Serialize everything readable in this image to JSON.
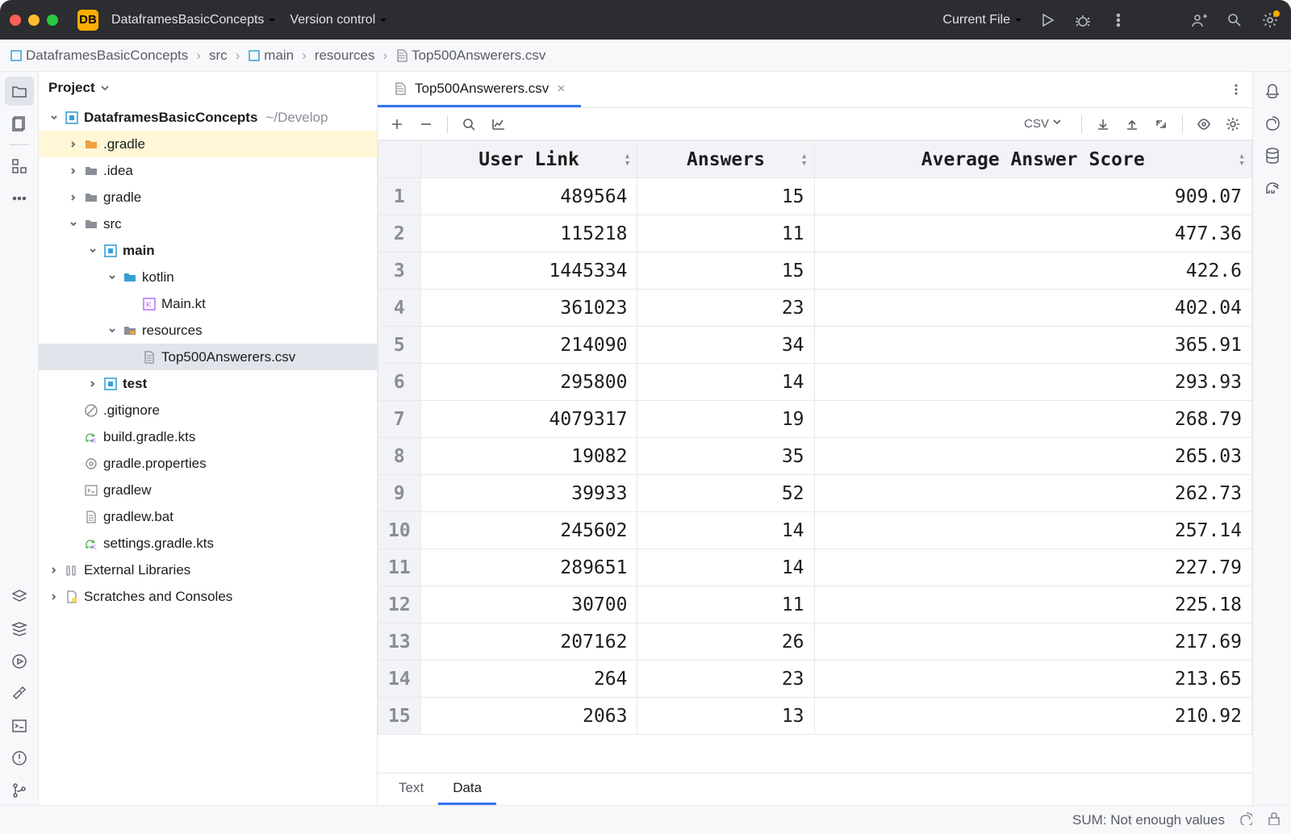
{
  "titlebar": {
    "project_name": "DataframesBasicConcepts",
    "version_control": "Version control",
    "run_target": "Current File"
  },
  "breadcrumb": {
    "items": [
      {
        "label": "DataframesBasicConcepts",
        "icon": "module"
      },
      {
        "label": "src"
      },
      {
        "label": "main",
        "icon": "module"
      },
      {
        "label": "resources"
      },
      {
        "label": "Top500Answerers.csv",
        "icon": "file"
      }
    ]
  },
  "project": {
    "title": "Project",
    "root": {
      "label": "DataframesBasicConcepts",
      "hint": "~/Develop"
    },
    "tree": [
      {
        "label": ".gradle",
        "depth": 1,
        "arrow": "right",
        "icon": "folder-orange",
        "highlighted": true
      },
      {
        "label": ".idea",
        "depth": 1,
        "arrow": "right",
        "icon": "folder"
      },
      {
        "label": "gradle",
        "depth": 1,
        "arrow": "right",
        "icon": "folder"
      },
      {
        "label": "src",
        "depth": 1,
        "arrow": "down",
        "icon": "folder"
      },
      {
        "label": "main",
        "depth": 2,
        "arrow": "down",
        "icon": "module",
        "bold": true
      },
      {
        "label": "kotlin",
        "depth": 3,
        "arrow": "down",
        "icon": "folder-blue"
      },
      {
        "label": "Main.kt",
        "depth": 4,
        "arrow": "",
        "icon": "kt-file"
      },
      {
        "label": "resources",
        "depth": 3,
        "arrow": "down",
        "icon": "folder-res"
      },
      {
        "label": "Top500Answerers.csv",
        "depth": 4,
        "arrow": "",
        "icon": "file",
        "selected": true
      },
      {
        "label": "test",
        "depth": 2,
        "arrow": "right",
        "icon": "module",
        "bold": true
      },
      {
        "label": ".gitignore",
        "depth": 1,
        "arrow": "",
        "icon": "ignore"
      },
      {
        "label": "build.gradle.kts",
        "depth": 1,
        "arrow": "",
        "icon": "gradle-kt"
      },
      {
        "label": "gradle.properties",
        "depth": 1,
        "arrow": "",
        "icon": "props"
      },
      {
        "label": "gradlew",
        "depth": 1,
        "arrow": "",
        "icon": "shell"
      },
      {
        "label": "gradlew.bat",
        "depth": 1,
        "arrow": "",
        "icon": "file"
      },
      {
        "label": "settings.gradle.kts",
        "depth": 1,
        "arrow": "",
        "icon": "gradle-kt"
      }
    ],
    "external_libs": "External Libraries",
    "scratches": "Scratches and Consoles"
  },
  "editor": {
    "tabs": [
      {
        "label": "Top500Answerers.csv",
        "active": true
      }
    ],
    "csv_format_label": "CSV",
    "view_tabs": {
      "text": "Text",
      "data": "Data"
    },
    "columns": [
      "User Link",
      "Answers",
      "Average Answer Score"
    ],
    "rows": [
      [
        "489564",
        "15",
        "909.07"
      ],
      [
        "115218",
        "11",
        "477.36"
      ],
      [
        "1445334",
        "15",
        "422.6"
      ],
      [
        "361023",
        "23",
        "402.04"
      ],
      [
        "214090",
        "34",
        "365.91"
      ],
      [
        "295800",
        "14",
        "293.93"
      ],
      [
        "4079317",
        "19",
        "268.79"
      ],
      [
        "19082",
        "35",
        "265.03"
      ],
      [
        "39933",
        "52",
        "262.73"
      ],
      [
        "245602",
        "14",
        "257.14"
      ],
      [
        "289651",
        "14",
        "227.79"
      ],
      [
        "30700",
        "11",
        "225.18"
      ],
      [
        "207162",
        "26",
        "217.69"
      ],
      [
        "264",
        "23",
        "213.65"
      ],
      [
        "2063",
        "13",
        "210.92"
      ]
    ]
  },
  "statusbar": {
    "sum": "SUM: Not enough values"
  }
}
